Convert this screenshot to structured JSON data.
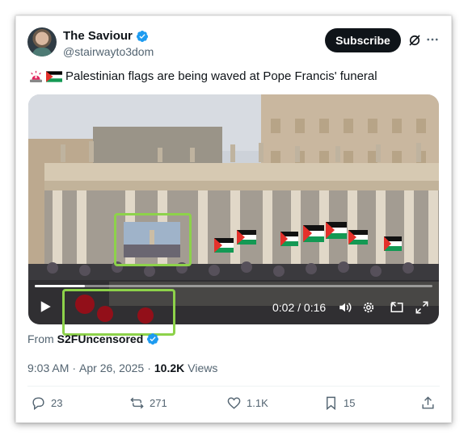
{
  "author": {
    "display_name": "The Saviour",
    "handle": "@stairwayto3dom",
    "verified": true,
    "subscribe_label": "Subscribe"
  },
  "tweet": {
    "emoji": [
      "police-light-emoji",
      "palestine-flag-emoji"
    ],
    "text": "Palestinian flags are being waved at Pope Francis' funeral"
  },
  "video": {
    "time_label": "0:02 / 0:16",
    "progress_percent": 12.5
  },
  "from": {
    "prefix": "From",
    "source": "S2FUncensored",
    "verified": true
  },
  "meta": {
    "time": "9:03 AM",
    "separator": "·",
    "date": "Apr 26, 2025",
    "views_count": "10.2K",
    "views_label": "Views"
  },
  "actions": {
    "reply_count": "23",
    "repost_count": "271",
    "like_count": "1.1K",
    "bookmark_count": "15"
  },
  "colors": {
    "verified_blue": "#1d9bf0",
    "subscribe_bg": "#0f1419",
    "muted_text": "#536471",
    "highlight_green": "#8dd24a"
  }
}
